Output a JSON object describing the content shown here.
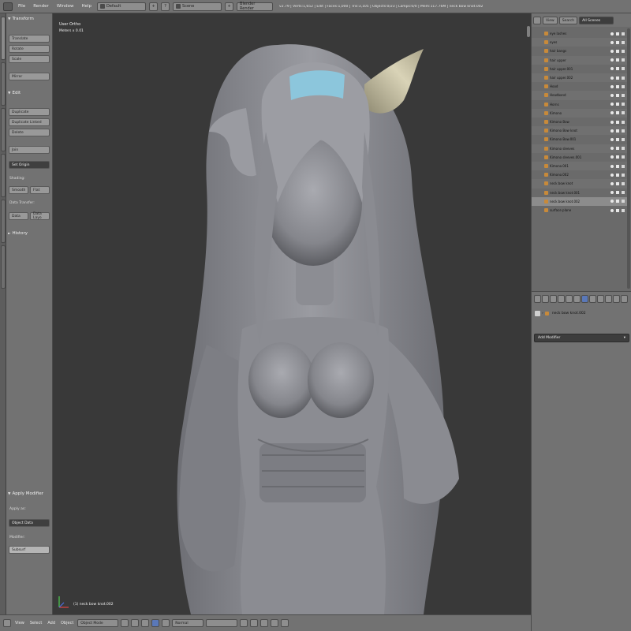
{
  "topbar": {
    "menus": [
      "File",
      "Render",
      "Window",
      "Help"
    ],
    "layout": "Default",
    "scene": "Scene",
    "engine": "Blender Render",
    "stats": "v2.79 | Verts:1,652 | Edit | Faces:1,000 | Tris:3,105 | Objects:0/23 | Lamps:0/0 | Mem:117.76M | neck bow knot.002"
  },
  "toolshelf": {
    "transform_title": "Transform",
    "translate": "Translate",
    "rotate": "Rotate",
    "scale": "Scale",
    "mirror": "Mirror",
    "edit_title": "Edit",
    "duplicate": "Duplicate",
    "duplicate_linked": "Duplicate Linked",
    "delete": "Delete",
    "join": "Join",
    "set_origin": "Set Origin",
    "shading_label": "Shading:",
    "smooth": "Smooth",
    "flat": "Flat",
    "data_transfer_label": "Data Transfer:",
    "data": "Data",
    "data_layout": "Data Layo",
    "history_title": "History",
    "apply_modifier_title": "Apply Modifier",
    "apply_as_label": "Apply as:",
    "apply_as_value": "Object Data",
    "modifier_label": "Modifier:",
    "modifier_value": "Subsurf"
  },
  "viewport": {
    "view_label": "User Ortho",
    "meters": "Meters x 0.01",
    "object_label": "(1) neck bow knot.002"
  },
  "bottombar": {
    "menus": [
      "View",
      "Select",
      "Add",
      "Object"
    ],
    "mode": "Object Mode",
    "pivot": "Normal"
  },
  "outliner": {
    "tabs": [
      "View",
      "Search",
      "All Scenes"
    ],
    "items": [
      "eye lashes",
      "eyes",
      "hair bangs",
      "hair upper",
      "hair upper.001",
      "hair upper.002",
      "Hood",
      "Headband",
      "Horns",
      "Kimono",
      "Kimono Bow",
      "Kimono Bow knot",
      "Kimono Bow.001",
      "Kimono sleeves",
      "Kimono sleeves.001",
      "Kimono.001",
      "Kimono.002",
      "neck bow knot",
      "neck bow knot.001",
      "neck bow knot.002",
      "surface plane"
    ],
    "selected_index": 19
  },
  "properties": {
    "object_name": "neck bow knot.002",
    "add_modifier": "Add Modifier"
  },
  "colors": {
    "viewport_bg": "#393939",
    "panel_bg": "#727272",
    "model_gray": "#8f9096",
    "headband_blue": "#8cc6dc",
    "horn_cream": "#c9c3a8"
  }
}
